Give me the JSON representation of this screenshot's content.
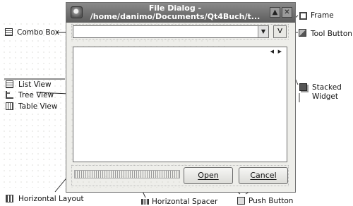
{
  "dialog": {
    "title_line1": "File Dialog -",
    "title_line2": "/home/danimo/Documents/Qt4Buch/t...",
    "minimize_glyph": "▲",
    "close_glyph": "✕",
    "combo_arrow_glyph": "▼",
    "tool_button_label": "V",
    "open_button": "Open",
    "cancel_button": "Cancel",
    "nav_prev_glyph": "◀",
    "nav_next_glyph": "▶"
  },
  "labels": {
    "combo_box": "Combo Box",
    "list_view": "List View",
    "tree_view": "Tree View",
    "table_view": "Table View",
    "horizontal_layout": "Horizontal Layout",
    "horizontal_spacer": "Horizontal Spacer",
    "push_button": "Push Button",
    "frame": "Frame",
    "tool_button": "Tool Button",
    "stacked_line1": "Stacked",
    "stacked_line2": "Widget"
  },
  "icons": {
    "combo_box": "combo-box-icon",
    "list_view": "list-view-icon",
    "tree_view": "tree-view-icon",
    "table_view": "table-view-icon",
    "horizontal_layout": "horizontal-layout-icon",
    "horizontal_spacer": "horizontal-spacer-icon",
    "push_button": "push-button-icon",
    "frame": "frame-icon",
    "tool_button": "tool-button-icon",
    "stacked_widget": "stacked-widget-icon"
  }
}
